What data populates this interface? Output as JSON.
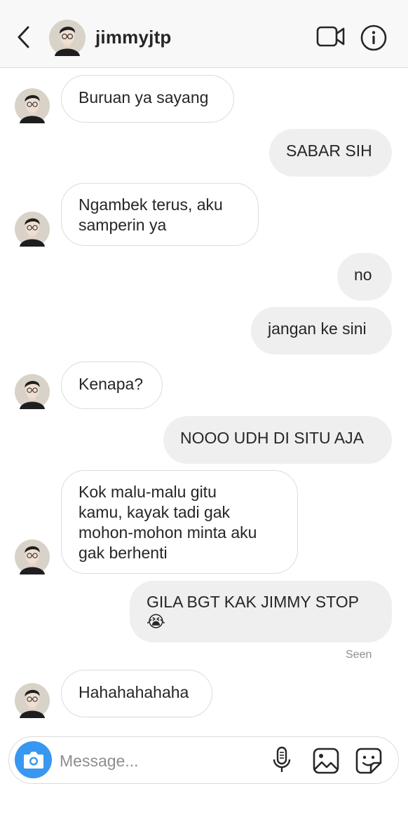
{
  "header": {
    "username": "jimmyjtp",
    "icons": [
      "chevron-left-icon",
      "avatar",
      "video-camera-icon",
      "info-icon"
    ]
  },
  "messages": [
    {
      "from": "them",
      "text": "Buruan ya sayang"
    },
    {
      "from": "me",
      "text": "SABAR SIH"
    },
    {
      "from": "them",
      "line1": "Ngambek terus, aku",
      "line2": "samperin ya"
    },
    {
      "from": "me",
      "text": "no"
    },
    {
      "from": "me",
      "text": "jangan ke sini"
    },
    {
      "from": "them",
      "text": "Kenapa?"
    },
    {
      "from": "me",
      "text": "NOOO UDH DI SITU AJA"
    },
    {
      "from": "them",
      "line1": "Kok malu-malu gitu",
      "line2": "kamu, kayak tadi gak",
      "line3": "mohon-mohon minta aku",
      "line4": "gak berhenti"
    },
    {
      "from": "me",
      "line1": "GILA BGT KAK JIMMY STOP",
      "line2": "😭"
    },
    {
      "from": "them",
      "text": "Hahahahahaha"
    }
  ],
  "seen_label": "Seen",
  "composer": {
    "placeholder": "Message...",
    "icons": [
      "camera-icon",
      "microphone-icon",
      "gallery-icon",
      "sticker-icon"
    ]
  },
  "colors": {
    "accent": "#3897f0",
    "outgoing_bubble": "#efefef",
    "incoming_border": "#dbdbdb",
    "header_bg": "#f8f8f8",
    "muted_text": "#8e8e8e"
  }
}
